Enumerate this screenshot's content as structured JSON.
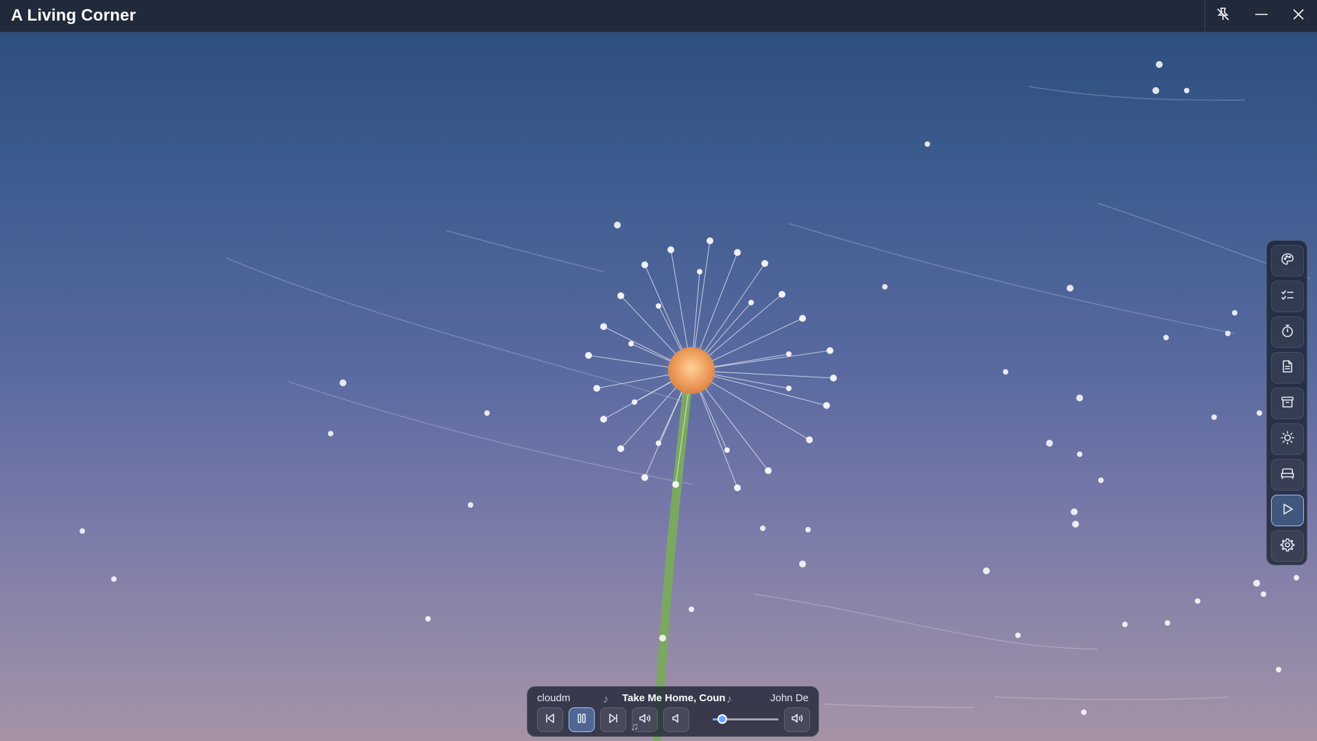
{
  "window": {
    "title": "A Living Corner",
    "controls": [
      "unpin-icon",
      "minimize-icon",
      "close-icon"
    ]
  },
  "scene": {
    "description_icon": "dandelion-scene",
    "sky_top_color": "#2e4f80",
    "sky_bottom_color": "#a692a6",
    "flower_center_color": "#f0a060",
    "stem_color": "#7aa860"
  },
  "sidebar": {
    "items": [
      {
        "id": "theme",
        "icon": "palette-icon",
        "active": false
      },
      {
        "id": "tasks",
        "icon": "checklist-icon",
        "active": false
      },
      {
        "id": "timer",
        "icon": "stopwatch-icon",
        "active": false
      },
      {
        "id": "notes",
        "icon": "note-icon",
        "active": false
      },
      {
        "id": "archive",
        "icon": "archive-icon",
        "active": false
      },
      {
        "id": "brightness",
        "icon": "sun-icon",
        "active": false
      },
      {
        "id": "sleep",
        "icon": "bed-icon",
        "active": false
      },
      {
        "id": "music",
        "icon": "play-icon",
        "active": true
      },
      {
        "id": "settings",
        "icon": "gear-icon",
        "active": false
      }
    ]
  },
  "player": {
    "left_label": "cloudm",
    "track_title": "Take Me Home, Coun",
    "artist": "John De",
    "volume": 0.15,
    "playing": true,
    "accent_color": "#6aa7ff"
  }
}
